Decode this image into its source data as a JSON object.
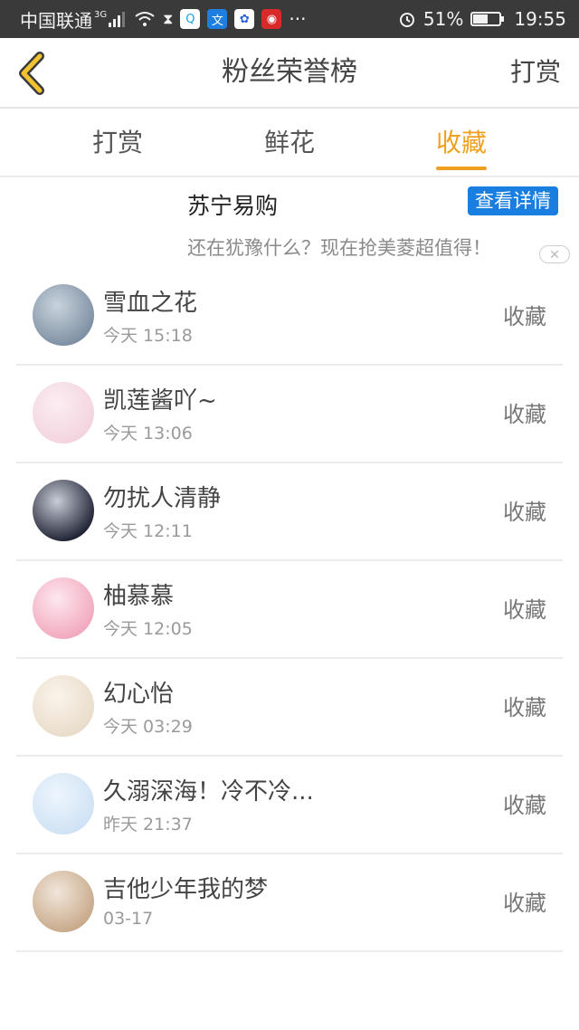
{
  "status_bar": {
    "carrier": "中国联通",
    "network": "3G",
    "more": "···",
    "battery": "51%",
    "battery_level": 0.51,
    "time": "19:55"
  },
  "header": {
    "title": "粉丝荣誉榜",
    "action_label": "打赏"
  },
  "tabs": [
    {
      "label": "打赏",
      "active": false
    },
    {
      "label": "鲜花",
      "active": false
    },
    {
      "label": "收藏",
      "active": true
    }
  ],
  "ad": {
    "title": "苏宁易购",
    "button_label": "查看详情",
    "subtitle": "还在犹豫什么？现在抢美菱超值得！",
    "close_label": "✕"
  },
  "list": [
    {
      "name": "雪血之花",
      "time": "今天 15:18",
      "action": "收藏",
      "avatar_colors": [
        "#7d8fa3",
        "#c9d3dc"
      ]
    },
    {
      "name": "凯莲酱吖~",
      "time": "今天 13:06",
      "action": "收藏",
      "avatar_colors": [
        "#f3d3df",
        "#fbeef2"
      ]
    },
    {
      "name": "勿扰人清静",
      "time": "今天 12:11",
      "action": "收藏",
      "avatar_colors": [
        "#1e2233",
        "#c8ccd6"
      ]
    },
    {
      "name": "柚慕慕",
      "time": "今天 12:05",
      "action": "收藏",
      "avatar_colors": [
        "#f2a8bf",
        "#fde7ee"
      ]
    },
    {
      "name": "幻心怡",
      "time": "今天 03:29",
      "action": "收藏",
      "avatar_colors": [
        "#e9dcc9",
        "#faf4ec"
      ]
    },
    {
      "name": "久溺深海！冷不冷...",
      "time": "昨天 21:37",
      "action": "收藏",
      "avatar_colors": [
        "#cfe2f5",
        "#eef5fc"
      ]
    },
    {
      "name": "吉他少年我的梦",
      "time": "03-17",
      "action": "收藏",
      "avatar_colors": [
        "#c8a98a",
        "#f1e6da"
      ]
    }
  ]
}
